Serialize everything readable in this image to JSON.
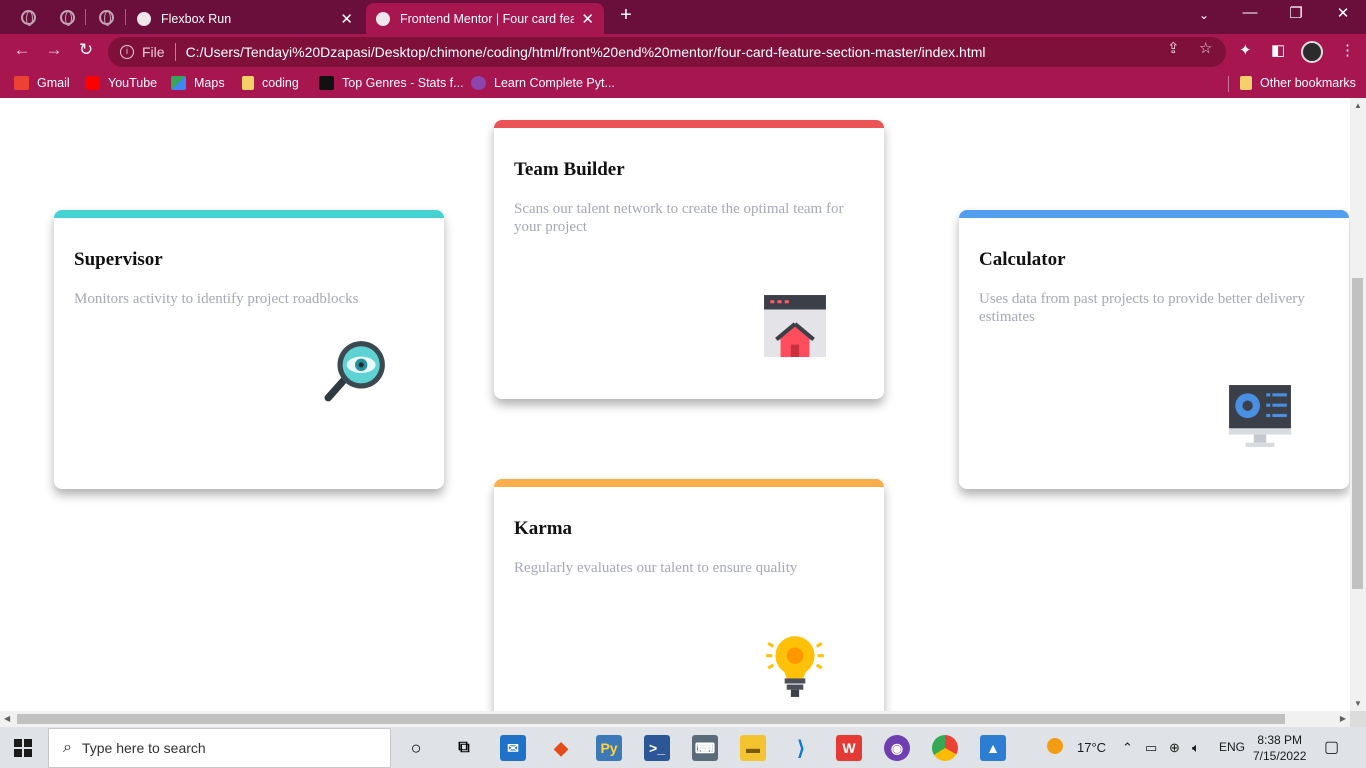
{
  "browser": {
    "tabs": [
      {
        "title": "Flexbox Run",
        "active": false
      },
      {
        "title": "Frontend Mentor | Four card feature section",
        "active": true
      }
    ],
    "new_tab_label": "+",
    "omnibox": {
      "scheme_label": "File",
      "url": "C:/Users/Tendayi%20Dzapasi/Desktop/chimone/coding/html/front%20end%20mentor/four-card-feature-section-master/index.html"
    },
    "bookmarks": [
      {
        "label": "Gmail",
        "icon": "gmail-icon",
        "color": "#ea4335"
      },
      {
        "label": "YouTube",
        "icon": "youtube-icon",
        "color": "#ff0000"
      },
      {
        "label": "Maps",
        "icon": "maps-icon",
        "color": "#34a853"
      },
      {
        "label": "coding",
        "icon": "folder-icon",
        "color": "#f5d06a"
      },
      {
        "label": "Top Genres - Stats f...",
        "icon": "stats-icon",
        "color": "#111111"
      },
      {
        "label": "Learn Complete Pyt...",
        "icon": "course-icon",
        "color": "#8e44ad"
      }
    ],
    "other_bookmarks": "Other bookmarks"
  },
  "page": {
    "cards": [
      {
        "key": "supervisor",
        "title": "Supervisor",
        "description": "Monitors activity to identify project roadblocks",
        "accent": "#44d3d2",
        "icon": "magnifier-eye-icon"
      },
      {
        "key": "team-builder",
        "title": "Team Builder",
        "description": "Scans our talent network to create the optimal team for your project",
        "accent": "#ea5454",
        "icon": "browser-house-icon"
      },
      {
        "key": "karma",
        "title": "Karma",
        "description": "Regularly evaluates our talent to ensure quality",
        "accent": "#fcae4a",
        "icon": "lightbulb-icon"
      },
      {
        "key": "calculator",
        "title": "Calculator",
        "description": "Uses data from past projects to provide better delivery estimates",
        "accent": "#549ef2",
        "icon": "monitor-chart-icon"
      }
    ]
  },
  "taskbar": {
    "search_placeholder": "Type here to search",
    "weather": "17°C",
    "language": "ENG",
    "time": "8:38 PM",
    "date": "7/15/2022"
  },
  "colors": {
    "tabstrip": "#6a0f3b",
    "toolbar": "#a8164f",
    "omnibox": "#7e1039",
    "text_gray": "#a6a9b5"
  }
}
